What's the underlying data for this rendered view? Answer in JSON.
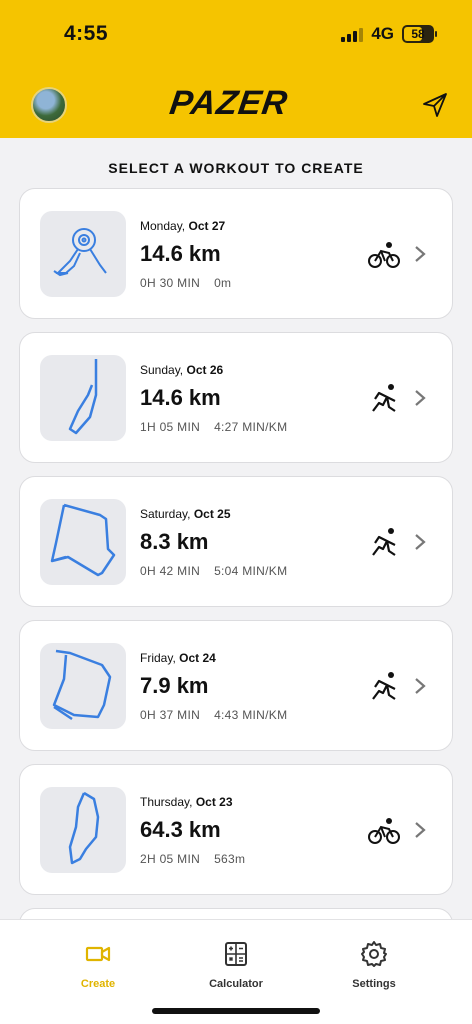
{
  "status": {
    "time": "4:55",
    "network": "4G",
    "battery": "58"
  },
  "header": {
    "logo": "PAZER"
  },
  "section_title": "SELECT A  WORKOUT TO CREATE",
  "workouts": [
    {
      "day": "Monday,",
      "date": "Oct 27",
      "distance": "14.6 km",
      "duration": "0H 30 MIN",
      "extra": "0m",
      "activity": "cycling"
    },
    {
      "day": "Sunday,",
      "date": "Oct 26",
      "distance": "14.6 km",
      "duration": "1H 05 MIN",
      "extra": "4:27 MIN/KM",
      "activity": "running"
    },
    {
      "day": "Saturday,",
      "date": "Oct 25",
      "distance": "8.3 km",
      "duration": "0H 42 MIN",
      "extra": "5:04 MIN/KM",
      "activity": "running"
    },
    {
      "day": "Friday,",
      "date": "Oct 24",
      "distance": "7.9 km",
      "duration": "0H 37 MIN",
      "extra": "4:43 MIN/KM",
      "activity": "running"
    },
    {
      "day": "Thursday,",
      "date": "Oct 23",
      "distance": "64.3 km",
      "duration": "2H 05 MIN",
      "extra": "563m",
      "activity": "cycling"
    }
  ],
  "tabs": [
    {
      "label": "Create",
      "icon": "video-camera-icon",
      "active": true
    },
    {
      "label": "Calculator",
      "icon": "calculator-icon",
      "active": false
    },
    {
      "label": "Settings",
      "icon": "gear-icon",
      "active": false
    }
  ],
  "colors": {
    "brand": "#f5c400",
    "route": "#3a7fe0"
  }
}
